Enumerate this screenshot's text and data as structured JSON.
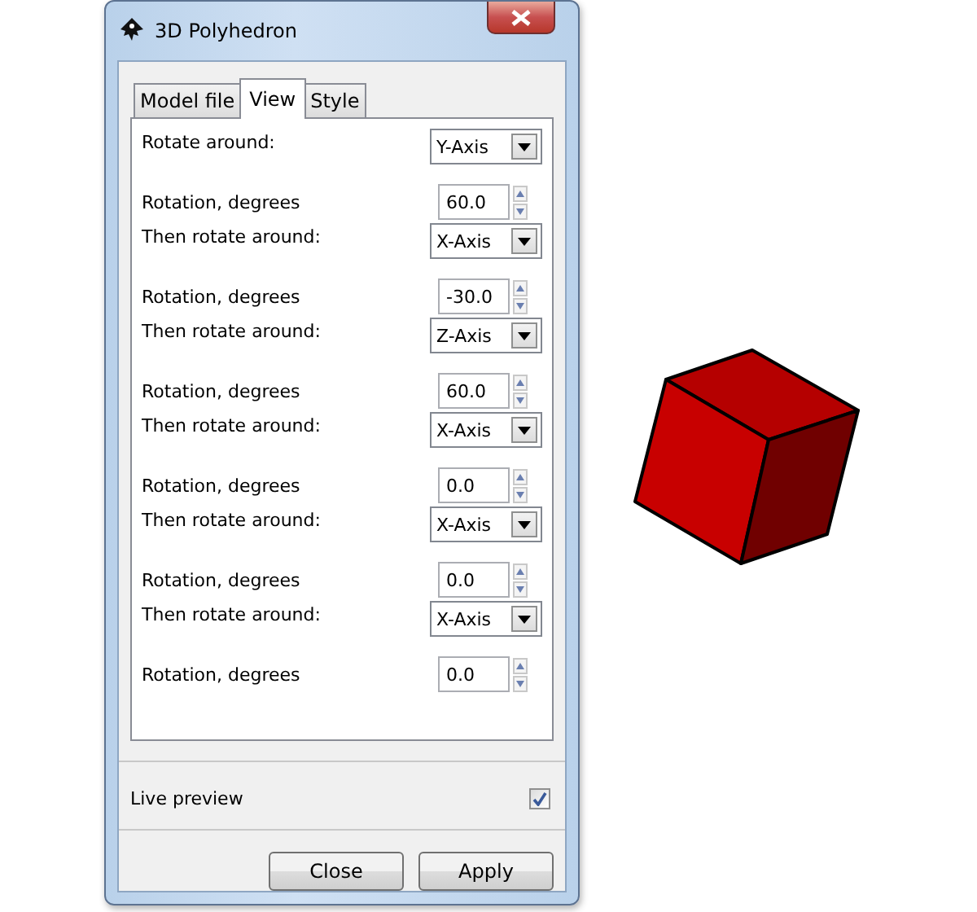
{
  "window": {
    "title": "3D Polyhedron"
  },
  "tabs": [
    {
      "label": "Model file",
      "selected": false
    },
    {
      "label": "View",
      "selected": true
    },
    {
      "label": "Style",
      "selected": false
    }
  ],
  "rows": [
    {
      "kind": "combo",
      "label": "Rotate around:",
      "value": "Y-Axis"
    },
    {
      "kind": "spin",
      "label": "Rotation, degrees",
      "value": "60.0"
    },
    {
      "kind": "combo",
      "label": "Then rotate around:",
      "value": "X-Axis"
    },
    {
      "kind": "spin",
      "label": "Rotation, degrees",
      "value": "-30.0"
    },
    {
      "kind": "combo",
      "label": "Then rotate around:",
      "value": "Z-Axis"
    },
    {
      "kind": "spin",
      "label": "Rotation, degrees",
      "value": "60.0"
    },
    {
      "kind": "combo",
      "label": "Then rotate around:",
      "value": "X-Axis"
    },
    {
      "kind": "spin",
      "label": "Rotation, degrees",
      "value": "0.0"
    },
    {
      "kind": "combo",
      "label": "Then rotate around:",
      "value": "X-Axis"
    },
    {
      "kind": "spin",
      "label": "Rotation, degrees",
      "value": "0.0"
    },
    {
      "kind": "combo",
      "label": "Then rotate around:",
      "value": "X-Axis"
    },
    {
      "kind": "spin",
      "label": "Rotation, degrees",
      "value": "0.0"
    }
  ],
  "live_preview": {
    "label": "Live preview",
    "checked": true
  },
  "buttons": [
    "Close",
    "Apply"
  ]
}
